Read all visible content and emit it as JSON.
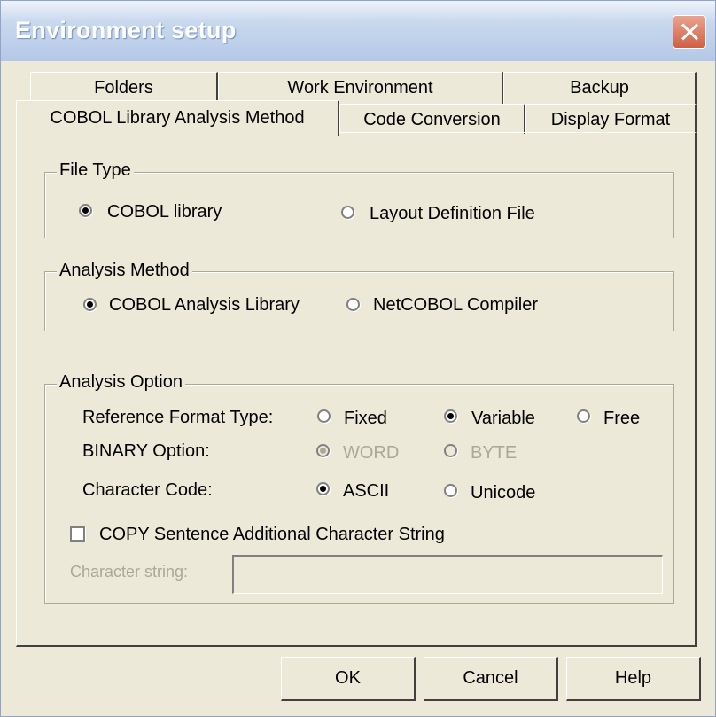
{
  "window": {
    "title": "Environment setup"
  },
  "tabs": {
    "row_back": [
      "Folders",
      "Work Environment",
      "Backup"
    ],
    "row_front": [
      "COBOL Library Analysis Method",
      "Code Conversion",
      "Display Format"
    ],
    "active": "COBOL Library Analysis Method"
  },
  "file_type": {
    "title": "File Type",
    "options": [
      "COBOL library",
      "Layout Definition File"
    ],
    "selected": "COBOL library"
  },
  "analysis_method": {
    "title": "Analysis Method",
    "options": [
      "COBOL Analysis Library",
      "NetCOBOL Compiler"
    ],
    "selected": "COBOL Analysis Library"
  },
  "analysis_option": {
    "title": "Analysis Option",
    "reference_format": {
      "label": "Reference Format Type:",
      "options": [
        "Fixed",
        "Variable",
        "Free"
      ],
      "selected": "Variable"
    },
    "binary_option": {
      "label": "BINARY Option:",
      "options": [
        "WORD",
        "BYTE"
      ],
      "selected": "WORD",
      "enabled": false
    },
    "character_code": {
      "label": "Character Code:",
      "options": [
        "ASCII",
        "Unicode"
      ],
      "selected": "ASCII"
    },
    "copy_sentence": {
      "label": "COPY Sentence Additional Character String",
      "checked": false
    },
    "character_string": {
      "label": "Character string:",
      "value": "",
      "enabled": false
    }
  },
  "buttons": {
    "ok": "OK",
    "cancel": "Cancel",
    "help": "Help"
  },
  "icons": {
    "close": "close-icon"
  },
  "colors": {
    "face": "#ece9d8",
    "disabled_text": "#aca899",
    "title_bar": "#b4c8e6",
    "close_button": "#cf5f45"
  }
}
